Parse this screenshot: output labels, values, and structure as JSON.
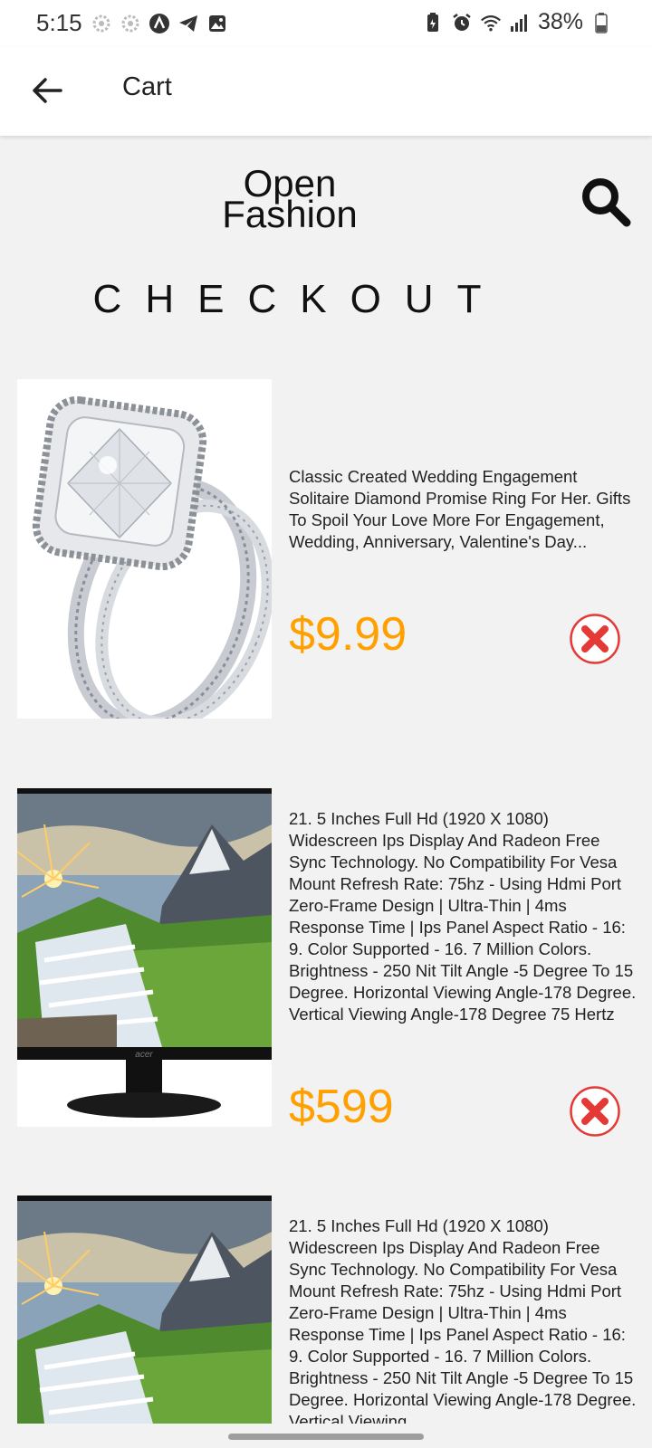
{
  "status_bar": {
    "time": "5:15",
    "battery": "38%",
    "left_icons": [
      "settings-icon",
      "settings-icon",
      "app-icon",
      "telegram-icon",
      "gallery-icon"
    ],
    "right_icons": [
      "battery-saver-icon",
      "alarm-icon",
      "wifi-icon",
      "signal-icon",
      "battery-icon"
    ]
  },
  "app_bar": {
    "title": "Cart",
    "back_icon": "arrow-left-icon"
  },
  "brand": {
    "line1": "Open",
    "line2": "Fashion",
    "search_icon": "search-icon"
  },
  "heading": "CHECKOUT",
  "items": [
    {
      "image": "diamond-ring-photo",
      "description": "Classic Created Wedding Engagement Solitaire Diamond Promise Ring For Her. Gifts To Spoil Your Love More For Engagement, Wedding, Anniversary, Valentine's Day...",
      "price": "$9.99",
      "remove_icon": "close-circle-icon"
    },
    {
      "image": "monitor-waterfall-photo",
      "description": "21. 5 Inches Full Hd (1920 X 1080) Widescreen Ips Display And Radeon Free Sync Technology. No Compatibility For Vesa Mount Refresh Rate: 75hz - Using Hdmi Port Zero-Frame Design | Ultra-Thin | 4ms Response Time | Ips Panel Aspect Ratio - 16: 9. Color Supported - 16. 7 Million Colors. Brightness - 250 Nit Tilt Angle -5 Degree To 15 Degree. Horizontal Viewing Angle-178 Degree. Vertical Viewing Angle-178 Degree 75 Hertz",
      "price": "$599",
      "remove_icon": "close-circle-icon",
      "monitor_brand": "acer"
    },
    {
      "image": "monitor-waterfall-photo",
      "description": "21. 5 Inches Full Hd (1920 X 1080) Widescreen Ips Display And Radeon Free Sync Technology. No Compatibility For Vesa Mount Refresh Rate: 75hz - Using Hdmi Port Zero-Frame Design | Ultra-Thin | 4ms Response Time | Ips Panel Aspect Ratio - 16: 9. Color Supported - 16. 7 Million Colors. Brightness - 250 Nit Tilt Angle -5 Degree To 15 Degree. Horizontal Viewing Angle-178 Degree. Vertical Viewing"
    }
  ],
  "colors": {
    "price": "#ffa000",
    "remove": "#e53935",
    "background": "#f2f2f2"
  }
}
